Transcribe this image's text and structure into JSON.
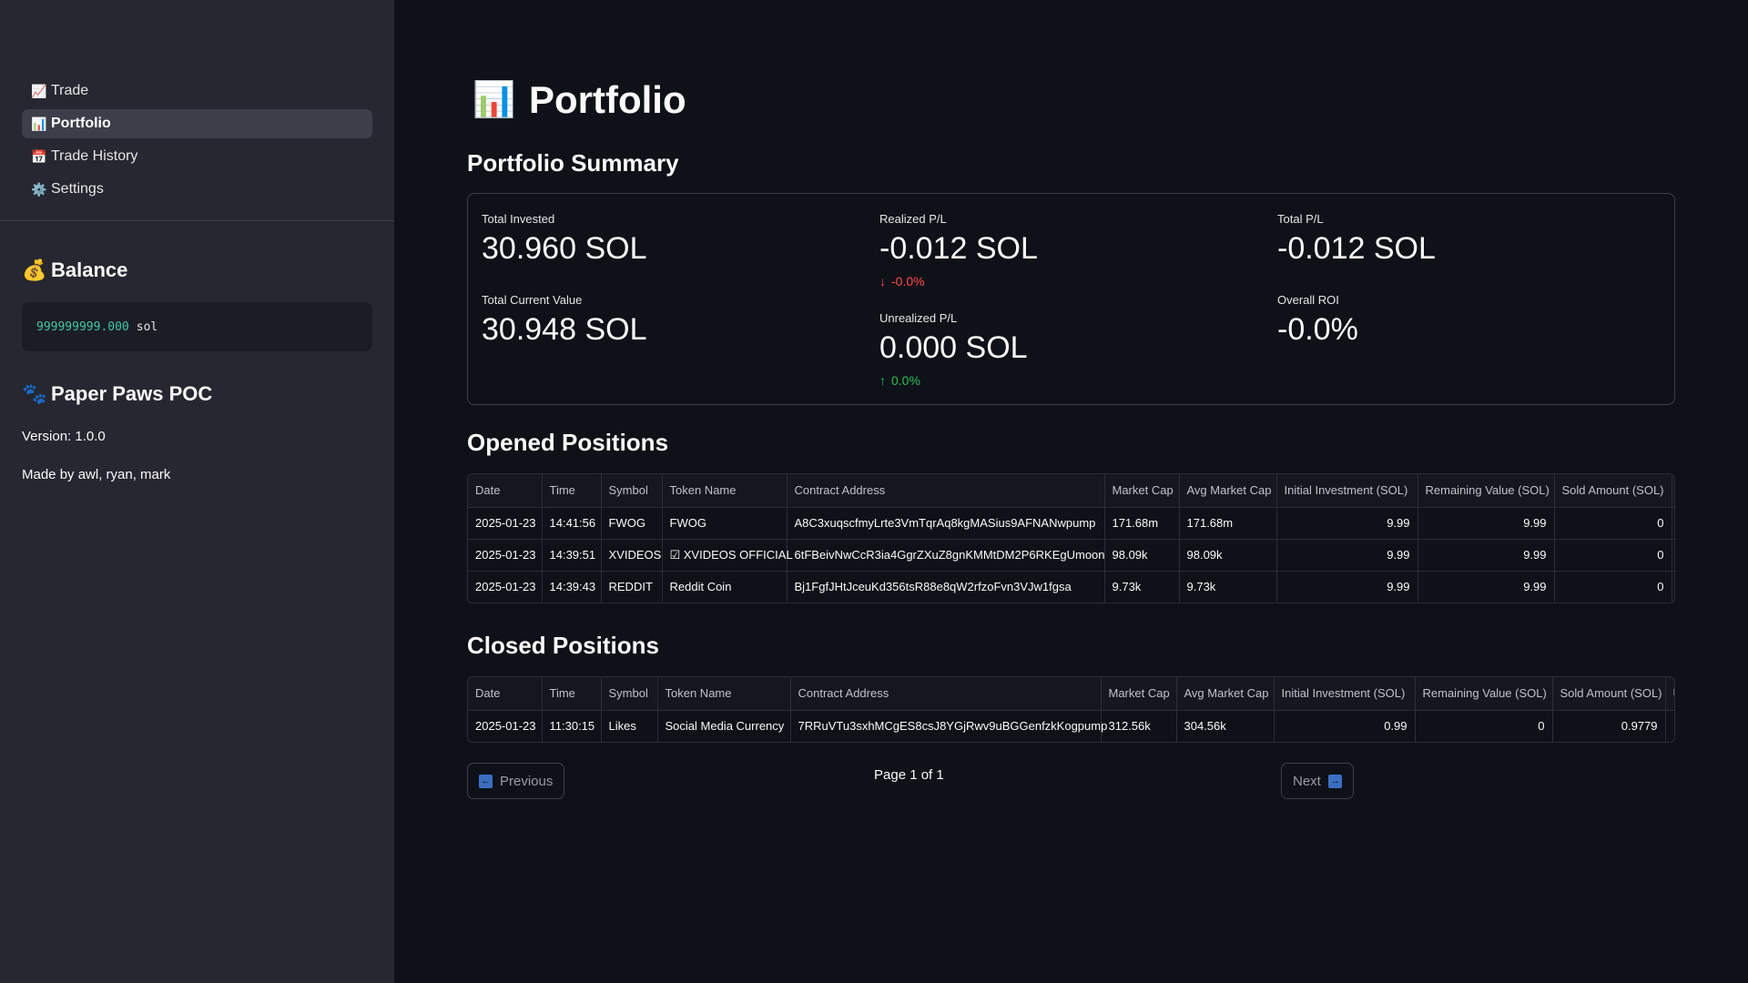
{
  "sidebar": {
    "nav": [
      {
        "icon": "📈",
        "label": "Trade",
        "active": false
      },
      {
        "icon": "📊",
        "label": "Portfolio",
        "active": true
      },
      {
        "icon": "📅",
        "label": "Trade History",
        "active": false
      },
      {
        "icon": "⚙️",
        "label": "Settings",
        "active": false
      }
    ],
    "balance": {
      "icon": "💰",
      "title": "Balance",
      "amount": "999999999.000",
      "unit": "sol"
    },
    "about": {
      "icon": "🐾",
      "title": "Paper Paws POC",
      "version": "Version: 1.0.0",
      "credits": "Made by awl, ryan, mark"
    }
  },
  "main": {
    "title_icon": "📊",
    "title": "Portfolio",
    "summary_title": "Portfolio Summary",
    "metrics": {
      "total_invested": {
        "label": "Total Invested",
        "value": "30.960 SOL"
      },
      "total_current": {
        "label": "Total Current Value",
        "value": "30.948 SOL"
      },
      "realized": {
        "label": "Realized P/L",
        "value": "-0.012 SOL",
        "delta": "-0.0%",
        "direction": "down"
      },
      "unrealized": {
        "label": "Unrealized P/L",
        "value": "0.000 SOL",
        "delta": "0.0%",
        "direction": "up"
      },
      "total_pl": {
        "label": "Total P/L",
        "value": "-0.012 SOL"
      },
      "roi": {
        "label": "Overall ROI",
        "value": "-0.0%"
      }
    },
    "opened_title": "Opened Positions",
    "closed_title": "Closed Positions",
    "columns": [
      "Date",
      "Time",
      "Symbol",
      "Token Name",
      "Contract Address",
      "Market Cap",
      "Avg Market Cap",
      "Initial Investment (SOL)",
      "Remaining Value (SOL)",
      "Sold Amount (SOL)",
      "U"
    ],
    "opened_rows": [
      [
        "2025-01-23",
        "14:41:56",
        "FWOG",
        "FWOG",
        "A8C3xuqscfmyLrte3VmTqrAq8kgMASius9AFNANwpump",
        "171.68m",
        "171.68m",
        "9.99",
        "9.99",
        "0",
        ""
      ],
      [
        "2025-01-23",
        "14:39:51",
        "XVIDEOS",
        "☑ XVIDEOS OFFICIAL",
        "6tFBeivNwCcR3ia4GgrZXuZ8gnKMMtDM2P6RKEgUmoon",
        "98.09k",
        "98.09k",
        "9.99",
        "9.99",
        "0",
        ""
      ],
      [
        "2025-01-23",
        "14:39:43",
        "REDDIT",
        "Reddit Coin",
        "Bj1FgfJHtJceuKd356tsR88e8qW2rfzoFvn3VJw1fgsa",
        "9.73k",
        "9.73k",
        "9.99",
        "9.99",
        "0",
        ""
      ]
    ],
    "closed_rows": [
      [
        "2025-01-23",
        "11:30:15",
        "Likes",
        "Social Media Currency",
        "7RRuVTu3sxhMCgES8csJ8YGjRwv9uBGGenfzkKogpump",
        "312.56k",
        "304.56k",
        "0.99",
        "0",
        "0.9779",
        ""
      ]
    ],
    "pagination": {
      "previous": "Previous",
      "next": "Next",
      "page_info": "Page 1 of 1"
    }
  }
}
